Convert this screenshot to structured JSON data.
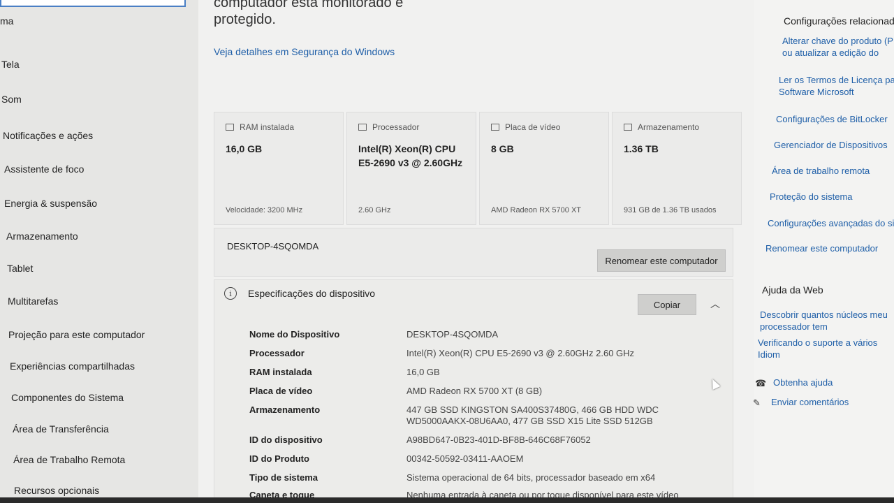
{
  "sidebar": {
    "section_label": "ma",
    "items": [
      {
        "label": "Tela"
      },
      {
        "label": "Som"
      },
      {
        "label": "Notificações e ações"
      },
      {
        "label": "Assistente de foco"
      },
      {
        "label": "Energia & suspensão"
      },
      {
        "label": "Armazenamento"
      },
      {
        "label": "Tablet"
      },
      {
        "label": "Multitarefas"
      },
      {
        "label": "Projeção para este computador"
      },
      {
        "label": "Experiências compartilhadas"
      },
      {
        "label": "Componentes do Sistema"
      },
      {
        "label": "Área de Transferência"
      },
      {
        "label": "Área de Trabalho Remota"
      },
      {
        "label": "Recursos opcionais"
      }
    ]
  },
  "main": {
    "protection_text_line1": "computador está monitorado e",
    "protection_text_line2": "protegido.",
    "security_link": "Veja detalhes em Segurança do Windows",
    "cards": [
      {
        "title": "RAM instalada",
        "value": "16,0 GB",
        "sub": "Velocidade: 3200 MHz",
        "icon": "ram-icon"
      },
      {
        "title": "Processador",
        "value": "Intel(R) Xeon(R) CPU E5-2690 v3 @ 2.60GHz",
        "sub": "2.60 GHz",
        "icon": "cpu-icon"
      },
      {
        "title": "Placa de vídeo",
        "value": "8 GB",
        "sub": "AMD Radeon RX 5700 XT",
        "icon": "gpu-icon"
      },
      {
        "title": "Armazenamento",
        "value": "1.36 TB",
        "sub": "931 GB de 1.36 TB usados",
        "icon": "storage-icon"
      }
    ],
    "computer_name": "DESKTOP-4SQOMDA",
    "rename_button": "Renomear este computador",
    "specs": {
      "title": "Especificações do dispositivo",
      "copy_button": "Copiar",
      "rows": [
        {
          "k": "Nome do Dispositivo",
          "v": "DESKTOP-4SQOMDA"
        },
        {
          "k": "Processador",
          "v": "Intel(R) Xeon(R) CPU E5-2690 v3 @ 2.60GHz   2.60 GHz"
        },
        {
          "k": "RAM instalada",
          "v": "16,0 GB"
        },
        {
          "k": "Placa de vídeo",
          "v": "AMD Radeon RX 5700 XT (8 GB)"
        },
        {
          "k": "Armazenamento",
          "v": "447 GB SSD KINGSTON SA400S37480G, 466 GB HDD WDC WD5000AAKX-08U6AA0, 477 GB SSD X15 Lite SSD 512GB"
        },
        {
          "k": "ID do dispositivo",
          "v": "A98BD647-0B23-401D-BF8B-646C68F76052"
        },
        {
          "k": "ID do Produto",
          "v": "00342-50592-03411-AAOEM"
        },
        {
          "k": "Tipo de sistema",
          "v": "Sistema operacional de 64 bits, processador baseado em x64"
        },
        {
          "k": "Caneta e toque",
          "v": "Nenhuma entrada à caneta ou por toque disponível para este vídeo"
        }
      ]
    }
  },
  "right": {
    "related_header": "Configurações relacionadas",
    "links": [
      "Alterar chave do produto (P Key) ou atualizar a edição do",
      "Ler os Termos de Licença para Software Microsoft",
      "Configurações de BitLocker",
      "Gerenciador de Dispositivos",
      "Área de trabalho remota",
      "Proteção do sistema",
      "Configurações avançadas do sist",
      "Renomear este computador"
    ],
    "web_header": "Ajuda da Web",
    "web_links": [
      "Descobrir quantos núcleos meu processador tem",
      "Verificando o suporte a vários Idiom"
    ],
    "help": "Obtenha ajuda",
    "feedback": "Enviar comentários"
  }
}
